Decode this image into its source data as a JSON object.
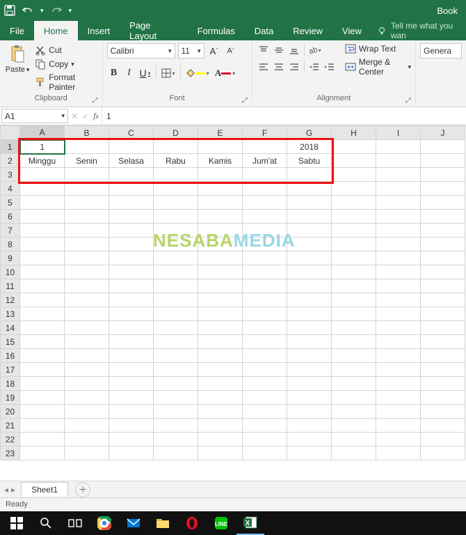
{
  "titlebar": {
    "book": "Book"
  },
  "tabs": {
    "file": "File",
    "home": "Home",
    "insert": "Insert",
    "page_layout": "Page Layout",
    "formulas": "Formulas",
    "data": "Data",
    "review": "Review",
    "view": "View",
    "tell": "Tell me what you wan"
  },
  "ribbon": {
    "clipboard": {
      "paste": "Paste",
      "cut": "Cut",
      "copy": "Copy",
      "format_painter": "Format Painter",
      "label": "Clipboard"
    },
    "font": {
      "name": "Calibri",
      "size": "11",
      "label": "Font",
      "bold": "B",
      "italic": "I",
      "underline": "U"
    },
    "alignment": {
      "wrap": "Wrap Text",
      "merge": "Merge & Center",
      "label": "Alignment"
    },
    "number": {
      "format": "Genera"
    }
  },
  "namebox": "A1",
  "formula": "1",
  "columns": [
    "A",
    "B",
    "C",
    "D",
    "E",
    "F",
    "G",
    "H",
    "I",
    "J"
  ],
  "rows_count": 23,
  "cells": {
    "A1": "1",
    "G1": "2018",
    "A2": "Minggu",
    "B2": "Senin",
    "C2": "Selasa",
    "D2": "Rabu",
    "E2": "Kamis",
    "F2": "Jum'at",
    "G2": "Sabtu"
  },
  "right_align": [
    "A1",
    "G1"
  ],
  "active_cell": "A1",
  "watermark": {
    "a": "NESABA",
    "b": "MEDIA"
  },
  "sheet": {
    "name": "Sheet1"
  },
  "status": "Ready"
}
